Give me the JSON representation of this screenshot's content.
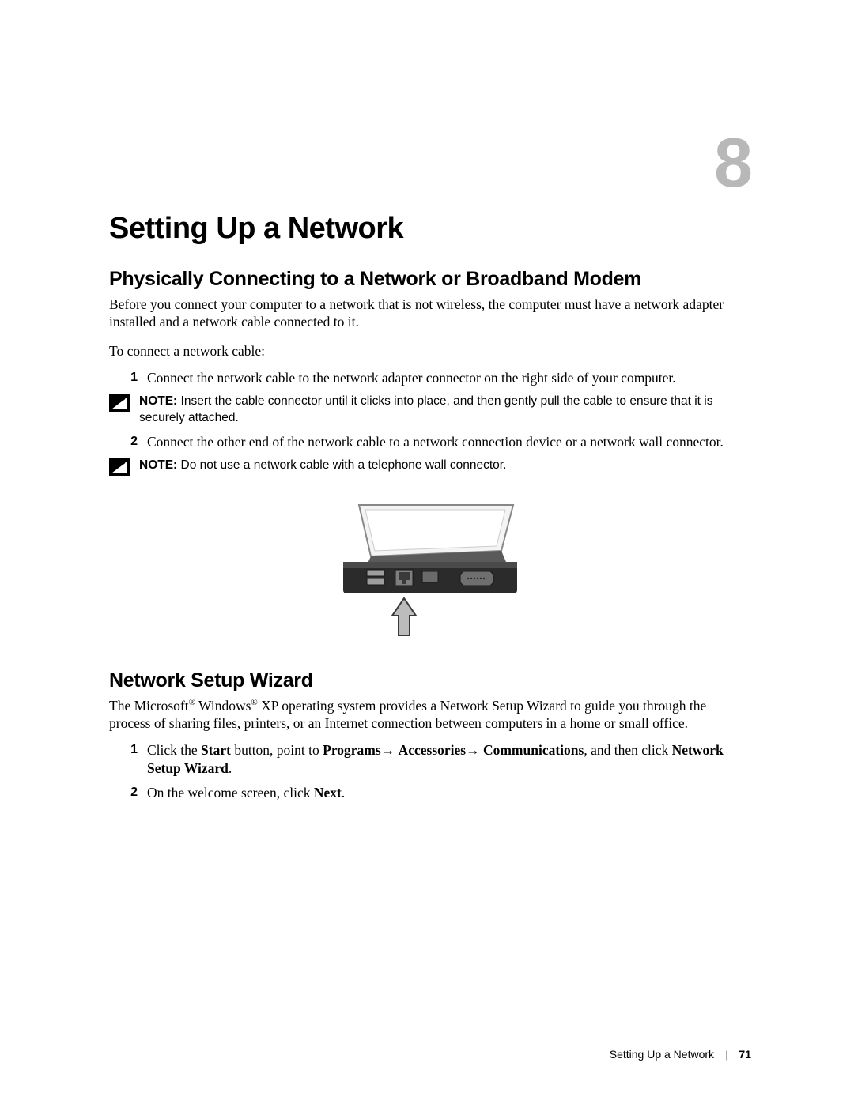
{
  "chapter": {
    "number": "8"
  },
  "h1": "Setting Up a Network",
  "section1": {
    "heading": "Physically Connecting to a Network or Broadband Modem",
    "intro": "Before you connect your computer to a network that is not wireless, the computer must have a network adapter installed and a network cable connected to it.",
    "lead": "To connect a network cable:",
    "step1_num": "1",
    "step1_text": "Connect the network cable to the network adapter connector on the right side of your computer.",
    "note1_label": "NOTE:",
    "note1_text": " Insert the cable connector until it clicks into place, and then gently pull the cable to ensure that it is securely attached.",
    "step2_num": "2",
    "step2_text": "Connect the other end of the network cable to a network connection device or a network wall connector.",
    "note2_label": "NOTE:",
    "note2_text": " Do not use a network cable with a telephone wall connector."
  },
  "section2": {
    "heading": "Network Setup Wizard",
    "intro_parts": {
      "p0": "The Microsoft",
      "reg1": "®",
      "p1": " Windows",
      "reg2": "®",
      "p2": " XP operating system provides a Network Setup Wizard to guide you through the process of sharing files, printers, or an Internet connection between computers in a home or small office."
    },
    "step1_num": "1",
    "step1_parts": {
      "p0": "Click the ",
      "b0": "Start",
      "p1": " button, point to ",
      "b1": "Programs",
      "arrow": "→ ",
      "b2": "Accessories",
      "b3": "Communications",
      "p2": ", and then click ",
      "b4": "Network Setup Wizard",
      "p3": "."
    },
    "step2_num": "2",
    "step2_parts": {
      "p0": "On the welcome screen, click ",
      "b0": "Next",
      "p1": "."
    }
  },
  "footer": {
    "title": "Setting Up a Network",
    "sep": "|",
    "page": "71"
  }
}
